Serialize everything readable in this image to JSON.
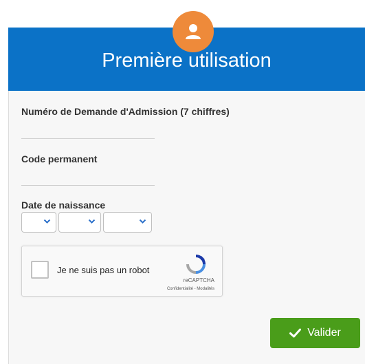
{
  "header": {
    "title": "Première utilisation",
    "avatar_icon": "user-icon",
    "background_color": "#0b72c7",
    "avatar_color": "#ee8a3a"
  },
  "form": {
    "admission_number": {
      "label": "Numéro de Demande d'Admission (7 chiffres)",
      "value": ""
    },
    "permanent_code": {
      "label": "Code permanent",
      "value": ""
    },
    "birth_date": {
      "label": "Date de naissance",
      "day": "",
      "month": "",
      "year": "",
      "chevron_icon": "chevron-down-icon"
    }
  },
  "captcha": {
    "checkbox_label": "Je ne suis pas un robot",
    "checked": false,
    "brand": "reCAPTCHA",
    "links": "Confidentialité - Modalités",
    "logo_icon": "recaptcha-icon"
  },
  "submit": {
    "label": "Valider",
    "icon": "check-icon",
    "color": "#4a9d1a"
  }
}
